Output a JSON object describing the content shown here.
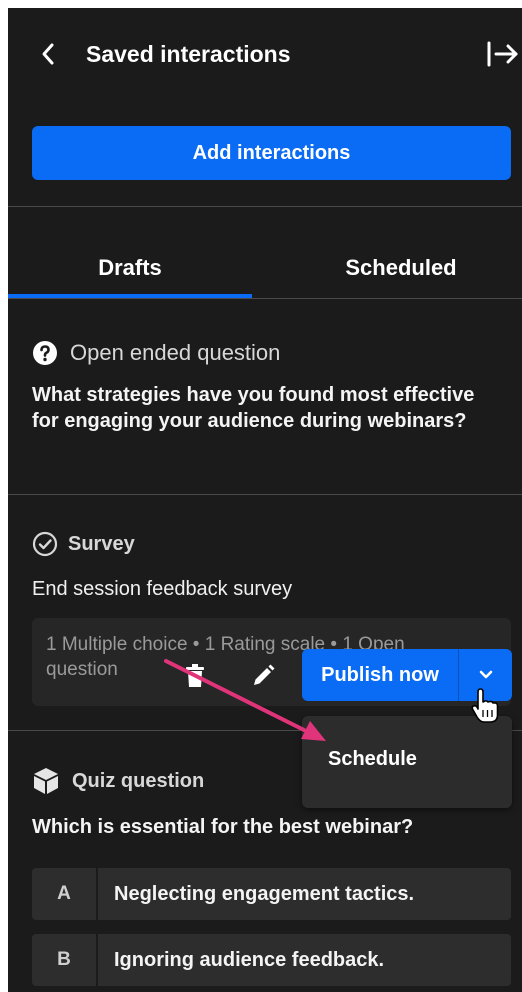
{
  "header": {
    "title": "Saved interactions",
    "back_icon": "chevron-left-icon",
    "exit_icon": "arrow-right-bar-icon"
  },
  "add_button": {
    "label": "Add interactions"
  },
  "tabs": [
    {
      "label": "Drafts",
      "active": true
    },
    {
      "label": "Scheduled",
      "active": false
    }
  ],
  "open_ended": {
    "type_label": "Open ended question",
    "icon": "question-circle-icon",
    "text": "What strategies have you found most effective for engaging your audience during webinars?"
  },
  "survey": {
    "type_label": "Survey",
    "icon": "check-circle-icon",
    "title": "End session feedback survey",
    "meta": "1 Multiple choice • 1 Rating scale • 1 Open question",
    "publish_label": "Publish now",
    "menu_items": [
      {
        "label": "Schedule"
      }
    ]
  },
  "quiz": {
    "type_label": "Quiz question",
    "icon": "cube-icon",
    "text": "Which is essential for the best webinar?",
    "options": [
      {
        "letter": "A",
        "text": "Neglecting engagement tactics."
      },
      {
        "letter": "B",
        "text": "Ignoring audience feedback."
      }
    ]
  },
  "colors": {
    "background": "#1b1b1b",
    "accent": "#0a6cf5",
    "annotation_arrow": "#e0347a"
  }
}
